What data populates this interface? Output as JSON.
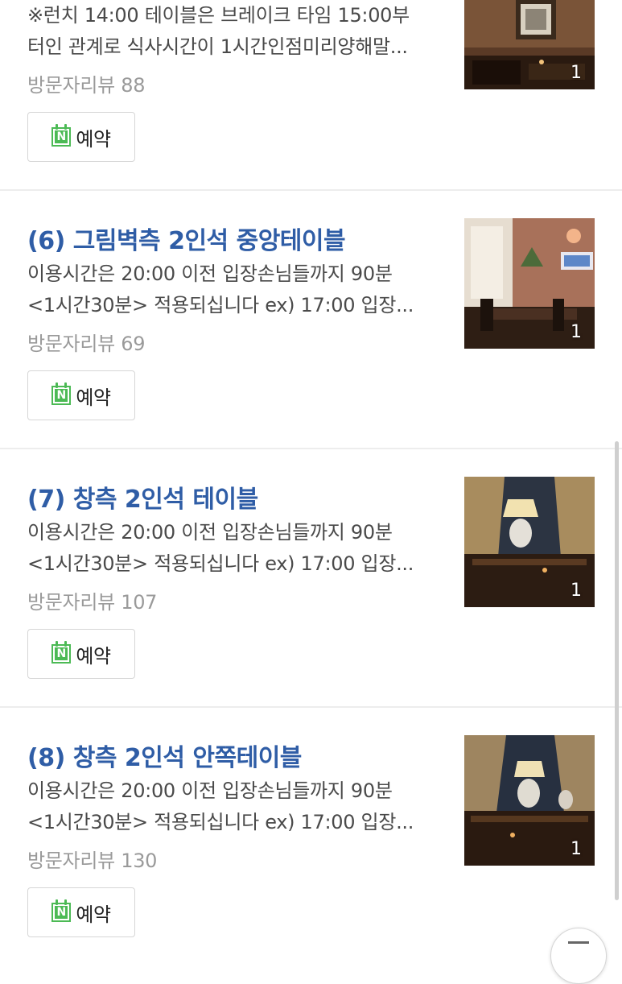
{
  "items": [
    {
      "title": "",
      "desc_line1": "※런치 14:00 테이블은 브레이크 타임 15:00부",
      "desc_line2": "터인 관계로 식사시간이 1시간인점미리양해말...",
      "review": "방문자리뷰 88",
      "book_label": "예약",
      "photo_count": "1"
    },
    {
      "title": "(6) 그림벽측 2인석 중앙테이블",
      "desc_line1": "이용시간은 20:00 이전 입장손님들까지 90분",
      "desc_line2": "<1시간30분> 적용되십니다 ex) 17:00 입장...",
      "review": "방문자리뷰 69",
      "book_label": "예약",
      "photo_count": "1"
    },
    {
      "title": "(7) 창측 2인석 테이블",
      "desc_line1": "이용시간은 20:00 이전 입장손님들까지 90분",
      "desc_line2": "<1시간30분> 적용되십니다 ex) 17:00 입장...",
      "review": "방문자리뷰 107",
      "book_label": "예약",
      "photo_count": "1"
    },
    {
      "title": "(8) 창측 2인석 안쪽테이블",
      "desc_line1": "이용시간은 20:00 이전 입장손님들까지 90분",
      "desc_line2": "<1시간30분> 적용되십니다 ex) 17:00 입장...",
      "review": "방문자리뷰 130",
      "book_label": "예약",
      "photo_count": "1"
    }
  ],
  "colors": {
    "title": "#2f5da6",
    "naver_green": "#4cba55"
  },
  "icons": {
    "booking": "naver-calendar-icon",
    "float": "menu-icon"
  }
}
